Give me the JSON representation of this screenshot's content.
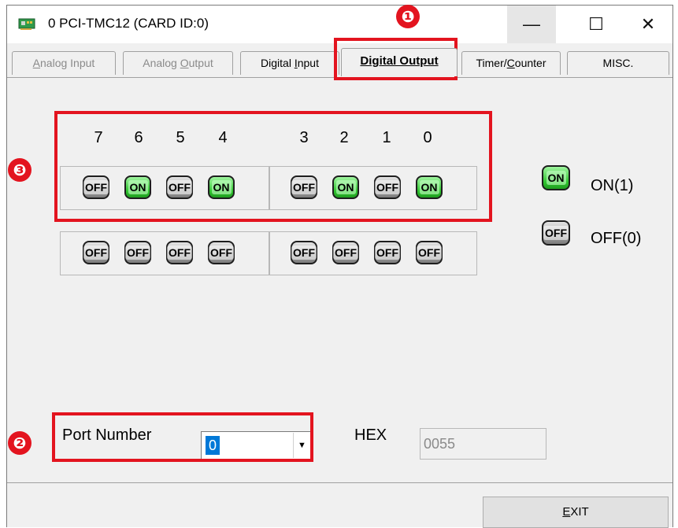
{
  "window": {
    "title": "0 PCI-TMC12 (CARD ID:0)",
    "min_glyph": "—",
    "max_glyph": "☐",
    "close_glyph": "✕"
  },
  "tabs": [
    {
      "mn": "A",
      "rest": "nalog Input",
      "state": "disabled"
    },
    {
      "pre": "Analog ",
      "mn": "O",
      "rest": "utput",
      "state": "disabled"
    },
    {
      "pre": "Digital ",
      "mn": "I",
      "rest": "nput",
      "state": "normal"
    },
    {
      "pre": "Digital Outpu",
      "mn": "t",
      "rest": "",
      "state": "active"
    },
    {
      "pre": "Timer/",
      "mn": "C",
      "rest": "ounter",
      "state": "normal"
    },
    {
      "pre": "MISC.",
      "mn": "",
      "rest": "",
      "state": "normal"
    }
  ],
  "bit_labels": [
    "7",
    "6",
    "5",
    "4",
    "3",
    "2",
    "1",
    "0"
  ],
  "led_rows": [
    [
      "OFF",
      "ON",
      "OFF",
      "ON",
      "OFF",
      "ON",
      "OFF",
      "ON"
    ],
    [
      "OFF",
      "OFF",
      "OFF",
      "OFF",
      "OFF",
      "OFF",
      "OFF",
      "OFF"
    ]
  ],
  "legend": {
    "on_led": "ON",
    "on_text": "ON(1)",
    "off_led": "OFF",
    "off_text": "OFF(0)"
  },
  "port": {
    "label": "Port Number",
    "value": "0",
    "arrow": "▼"
  },
  "hex": {
    "label": "HEX",
    "value": "0055"
  },
  "exit": {
    "mn": "E",
    "rest": "XIT"
  },
  "annotations": [
    "❶",
    "❷",
    "❸"
  ],
  "colors": {
    "annotation_red": "#e3141f",
    "led_on": "#2fc42f",
    "led_off": "#9a9a9a",
    "selection": "#0078d7"
  }
}
